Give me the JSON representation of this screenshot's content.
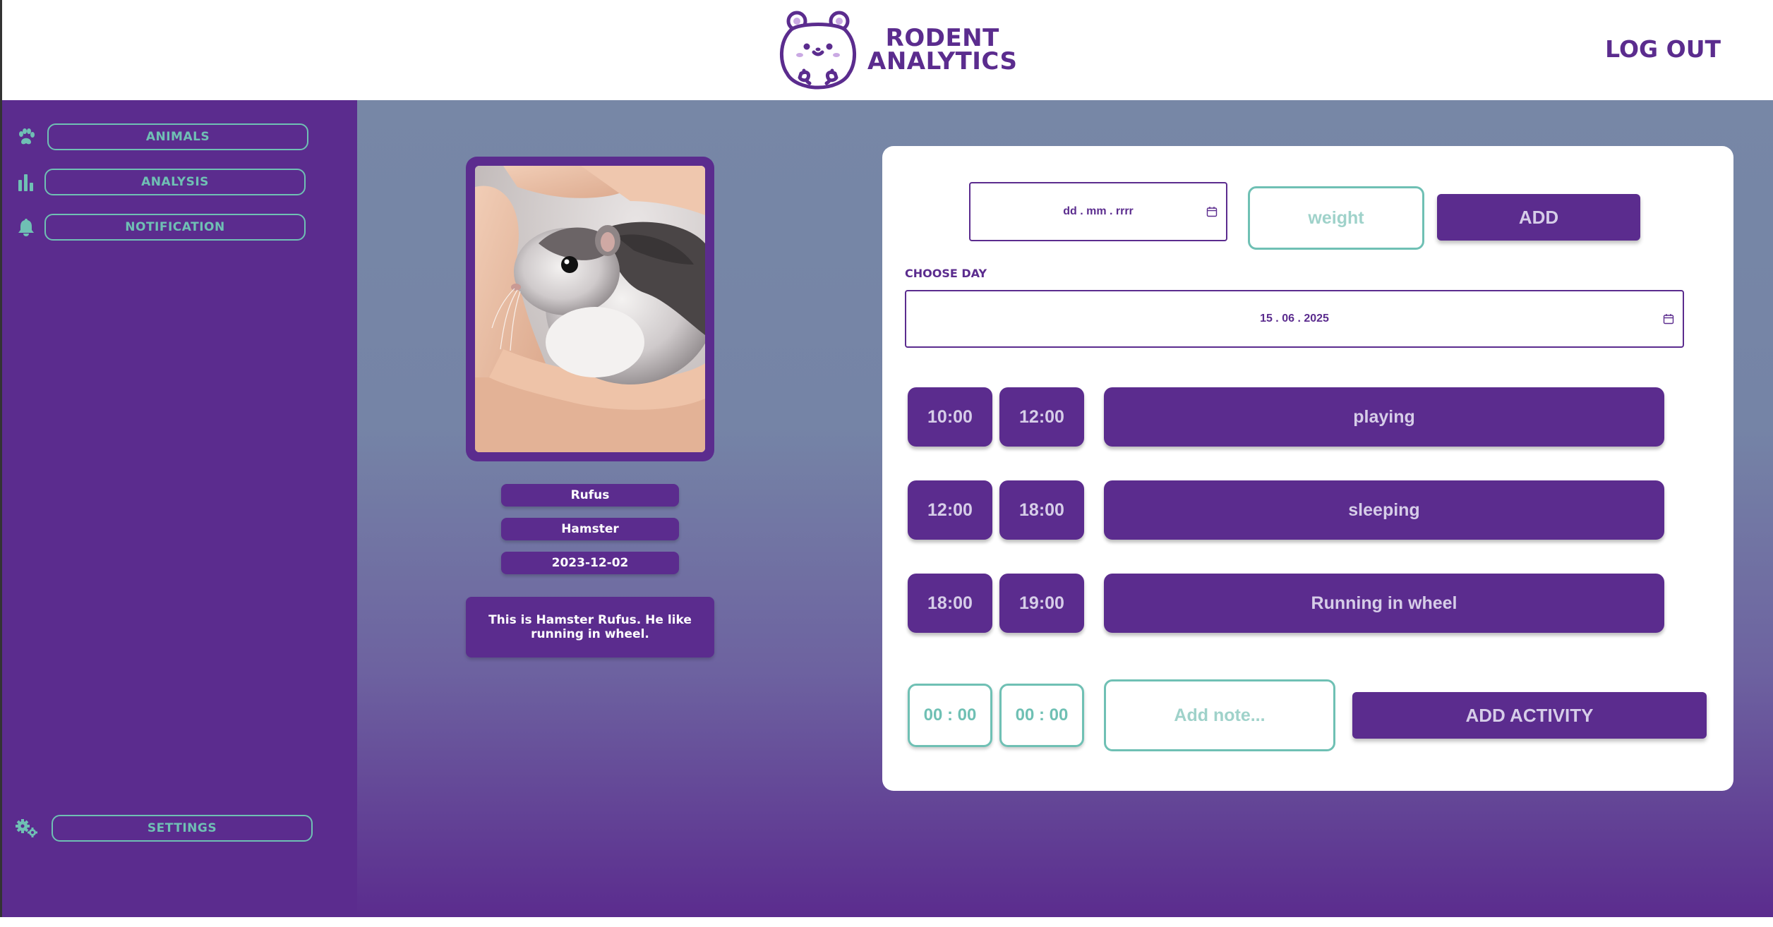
{
  "brand": {
    "line1": "RODENT",
    "line2": "ANALYTICS",
    "logo_icon": "hamster-logo-icon"
  },
  "header": {
    "logout_label": "LOG OUT"
  },
  "sidebar": {
    "items": [
      {
        "label": "ANIMALS",
        "icon": "paw-icon"
      },
      {
        "label": "ANALYSIS",
        "icon": "bar-chart-icon"
      },
      {
        "label": "NOTIFICATION",
        "icon": "bell-icon"
      }
    ],
    "settings": {
      "label": "SETTINGS",
      "icon": "gears-icon"
    }
  },
  "animal": {
    "name": "Rufus",
    "species": "Hamster",
    "birthdate": "2023-12-02",
    "description": "This is Hamster Rufus. He like running in wheel."
  },
  "weight_form": {
    "date_placeholder": "dd . mm . rrrr",
    "weight_placeholder": "weight",
    "add_label": "ADD"
  },
  "day_picker": {
    "label": "CHOOSE DAY",
    "value": "15 . 06 . 2025"
  },
  "activities": [
    {
      "start": "10:00",
      "end": "12:00",
      "name": "playing"
    },
    {
      "start": "12:00",
      "end": "18:00",
      "name": "sleeping"
    },
    {
      "start": "18:00",
      "end": "19:00",
      "name": "Running in wheel"
    }
  ],
  "new_activity": {
    "start_placeholder": "00 : 00",
    "end_placeholder": "00 : 00",
    "note_placeholder": "Add note...",
    "add_label": "ADD ACTIVITY"
  },
  "colors": {
    "primary": "#5b2c8e",
    "accent": "#6fc0b4",
    "background_top": "#7787a6",
    "text_light": "#d6cde8"
  }
}
